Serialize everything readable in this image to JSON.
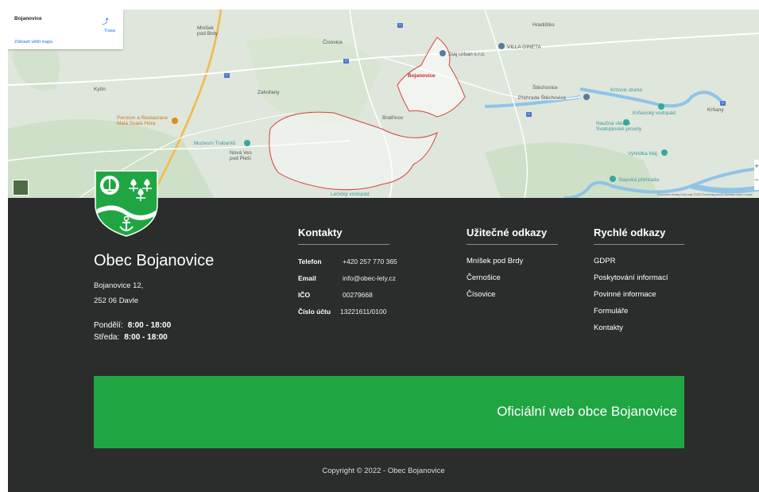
{
  "map": {
    "card_title": "Bojanovice",
    "card_link": "Zobrazit větší mapu",
    "route_label": "Trasa",
    "labels": {
      "hradistko": "Hradištko",
      "mnisek": "Mníšek\npod Brdy",
      "cisovice": "Čísovice",
      "staj": "Stáj Urban s.r.o.",
      "villa": "VILLA GINETA",
      "bojanovice": "Bojanovice",
      "stechovice": "Štěchovice",
      "prehrada": "Přehrada Štěchovice",
      "krovic": "Krčovic draha",
      "krnansky": "Krňanský vodopád",
      "krnany": "Krňany",
      "kytin": "Kytín",
      "zahorany": "Zahořany",
      "bratrinov": "Bratřínov",
      "penzion": "Penzion a Restaurace\nMalá Svatá Hora",
      "naucni": "Naučná stezka\nSvatojánské proudy",
      "muzeum": "Muzeum Trabantů",
      "nova_ves": "Nová Ves\npod Pleší",
      "vyhlidka": "Vyhlídka Máj",
      "slapska": "Slapská přehrada",
      "lecicky": "Lečický vodopád"
    },
    "zoom_in": "+",
    "zoom_out": "−",
    "attribution": "Klávesové zkratky   Data map ©2022   Podmínky použití   Nahlásit chybu v mapě"
  },
  "footer": {
    "municipality": "Obec Bojanovice",
    "address_line1": "Bojanovice 12,",
    "address_line2": "252 06 Davle",
    "hours": [
      {
        "day": "Pondělí:",
        "time": "8:00 - 18:00"
      },
      {
        "day": "Středa:",
        "time": "8:00 - 18:00"
      }
    ],
    "contacts": {
      "heading": "Kontakty",
      "rows": [
        {
          "key": "Telefon",
          "value": "+420 257 770 365"
        },
        {
          "key": "Email",
          "value": "info@obec-lety.cz"
        },
        {
          "key": "IČO",
          "value": "00279668"
        },
        {
          "key": "Číslo účtu",
          "value": "13221611/0100"
        }
      ]
    },
    "useful_links": {
      "heading": "Užitečné odkazy",
      "items": [
        "Mníšek pod Brdy",
        "Černošice",
        "Čísovice"
      ]
    },
    "quick_links": {
      "heading": "Rychlé odkazy",
      "items": [
        "GDPR",
        "Poskytování informací",
        "Povinné informace",
        "Formuláře",
        "Kontakty"
      ]
    },
    "banner_text": "Oficiální web obce Bojanovice",
    "copyright": "Copyright © 2022 - Obec Bojanovice"
  },
  "colors": {
    "footer_bg": "#2b2d2c",
    "banner_green": "#1fa643",
    "crest_green": "#1fa643"
  }
}
